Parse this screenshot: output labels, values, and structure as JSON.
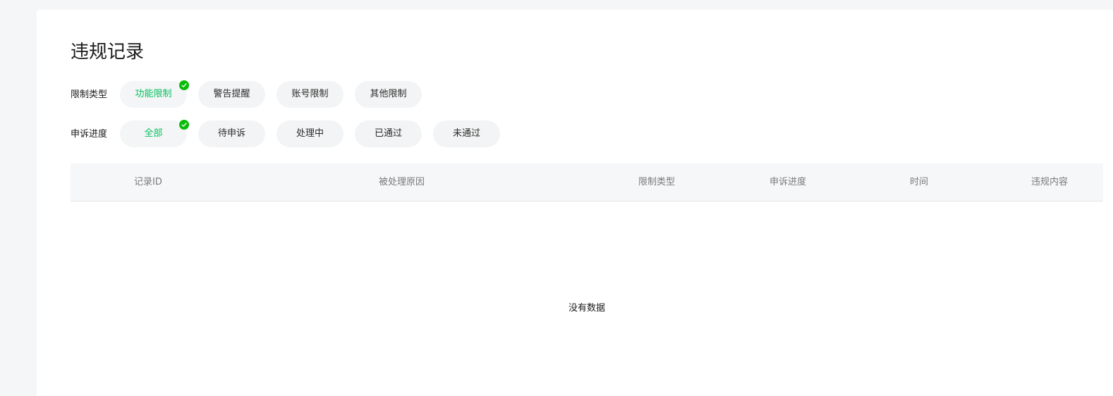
{
  "page": {
    "title": "违规记录"
  },
  "filters": {
    "restriction_type": {
      "label": "限制类型",
      "selected": "功能限制",
      "options": [
        "功能限制",
        "警告提醒",
        "账号限制",
        "其他限制"
      ]
    },
    "appeal_progress": {
      "label": "申诉进度",
      "selected": "全部",
      "options": [
        "全部",
        "待申诉",
        "处理中",
        "已通过",
        "未通过"
      ]
    }
  },
  "table": {
    "columns": [
      "记录ID",
      "被处理原因",
      "限制类型",
      "申诉进度",
      "时间",
      "违规内容"
    ],
    "rows": [],
    "empty_text": "没有数据"
  },
  "colors": {
    "accent": "#07c160",
    "badge": "#09bb07",
    "chip_bg": "#f3f4f5",
    "page_bg": "#f5f6f7"
  }
}
